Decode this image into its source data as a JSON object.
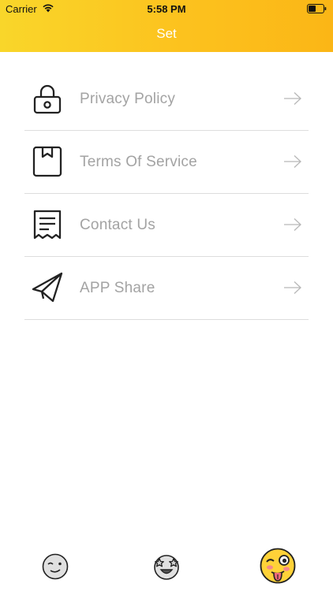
{
  "status_bar": {
    "carrier": "Carrier",
    "time": "5:58 PM"
  },
  "nav": {
    "title": "Set"
  },
  "menu": {
    "items": [
      {
        "label": "Privacy Policy",
        "icon": "lock-icon"
      },
      {
        "label": "Terms Of Service",
        "icon": "bookmark-box-icon"
      },
      {
        "label": "Contact Us",
        "icon": "receipt-icon"
      },
      {
        "label": "APP Share",
        "icon": "paper-plane-icon"
      }
    ]
  },
  "tab_bar": {
    "tabs": [
      {
        "icon": "winking-face-icon",
        "selected": false
      },
      {
        "icon": "star-struck-face-icon",
        "selected": false
      },
      {
        "icon": "tongue-wink-face-icon",
        "selected": true
      }
    ]
  },
  "colors": {
    "accent": "#fcc21e",
    "label": "#a3a3a3",
    "divider": "#dddddd"
  }
}
